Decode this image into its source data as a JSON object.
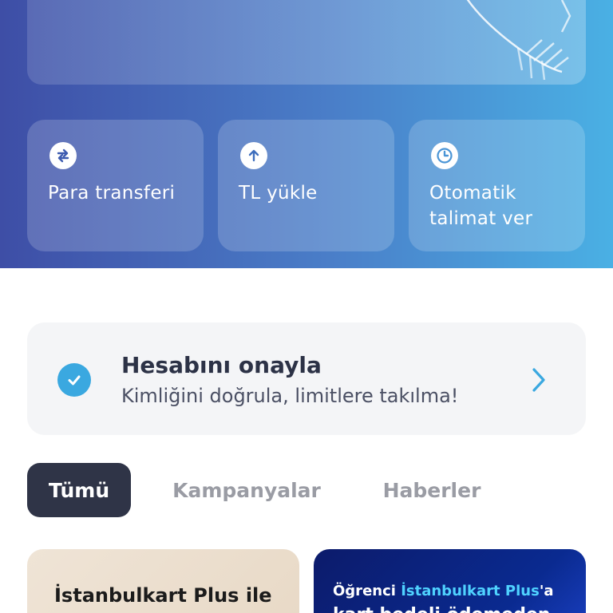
{
  "actions": [
    {
      "label": "Para transferi",
      "icon": "transfer-arrows-icon"
    },
    {
      "label": "TL yükle",
      "icon": "arrow-up-icon"
    },
    {
      "label": "Otomatik talimat ver",
      "icon": "clock-icon"
    }
  ],
  "verify": {
    "title": "Hesabını onayla",
    "subtitle": "Kimliğini doğrula, limitlere takılma!"
  },
  "tabs": [
    {
      "label": "Tümü",
      "active": true
    },
    {
      "label": "Kampanyalar",
      "active": false
    },
    {
      "label": "Haberler",
      "active": false
    }
  ],
  "promos": [
    {
      "text": "İstanbulkart Plus ile"
    },
    {
      "prefix": "Öğrenci ",
      "brand": "İstanbulkart Plus",
      "suffix": "'a",
      "line2": "kart bedeli ödemeden"
    }
  ],
  "colors": {
    "accent": "#3aa8e0",
    "tab_active_bg": "#2f3447",
    "hero_start": "#3e4ea6",
    "hero_end": "#4ab0e4"
  }
}
